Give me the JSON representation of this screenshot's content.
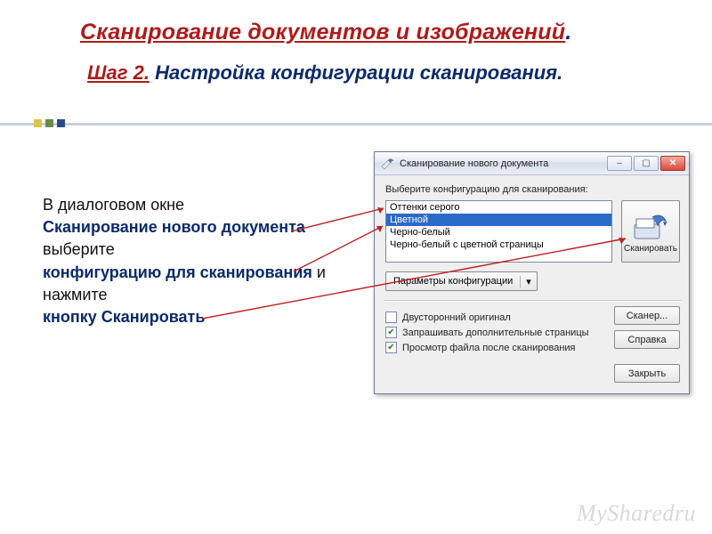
{
  "title": {
    "line1_underlined": "Сканирование документов и изображений",
    "line1_dot": ".",
    "step_label": "Шаг 2.",
    "line2_rest": " Настройка конфигурации сканирования."
  },
  "body": {
    "t1": "В диалоговом окне",
    "t2": "Сканирование нового документа",
    "t3": "выберите",
    "t4": "конфигурацию для сканирования",
    "t4b": " и",
    "t5": "нажмите",
    "t6": "кнопку Сканировать"
  },
  "dialog": {
    "title": "Сканирование нового документа",
    "prompt": "Выберите конфигурацию для сканирования:",
    "options": {
      "o0": "Оттенки серого",
      "o1": "Цветной",
      "o2": "Черно-белый",
      "o3": "Черно-белый с цветной страницы"
    },
    "scan_button": "Сканировать",
    "params_button": "Параметры конфигурации",
    "chk_duplex": "Двусторонний оригинал",
    "chk_more": "Запрашивать дополнительные страницы",
    "chk_preview": "Просмотр файла после сканирования",
    "btn_scanner": "Сканер...",
    "btn_help": "Справка",
    "btn_close": "Закрыть"
  },
  "watermark": "MySharedru"
}
